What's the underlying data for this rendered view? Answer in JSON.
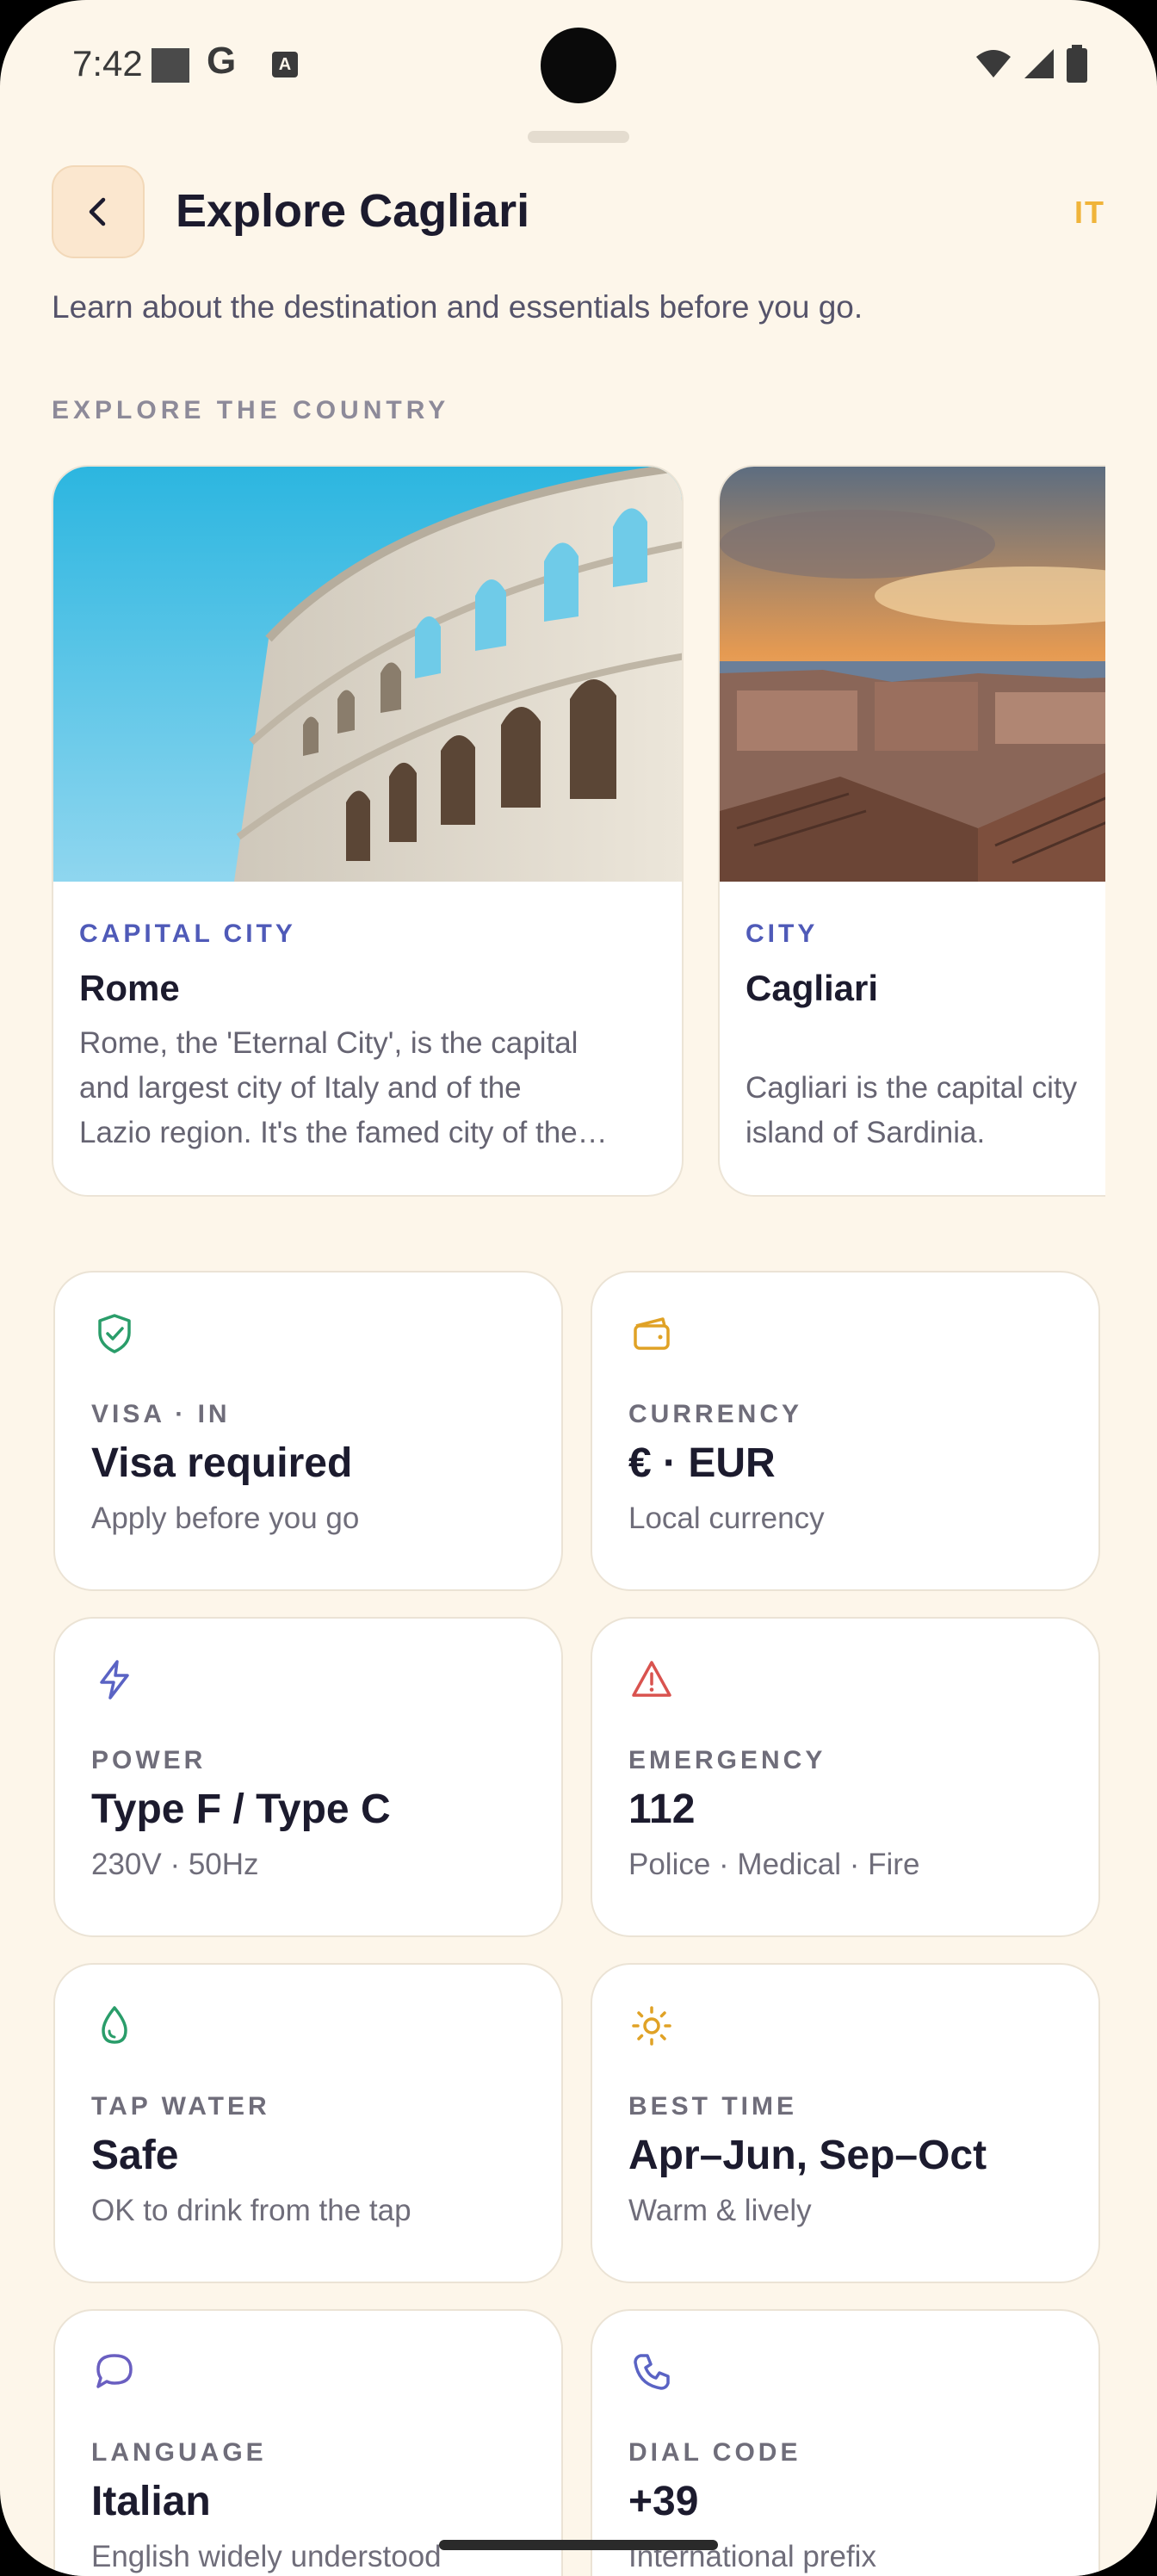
{
  "status_bar": {
    "time": "7:42",
    "g_glyph": "G",
    "a_glyph": "A",
    "icons": [
      "wifi-icon",
      "signal-icon",
      "battery-icon"
    ]
  },
  "header": {
    "title": "Explore Cagliari",
    "lang_code": "IT",
    "back_icon": "chevron-left-icon"
  },
  "subtitle": "Learn about the destination and essentials before you go.",
  "section_label": "EXPLORE THE COUNTRY",
  "places": [
    {
      "kind": "CAPITAL CITY",
      "name": "Rome",
      "desc_lines": [
        "Rome, the 'Eternal City', is the capital",
        "and largest city of Italy and of the",
        "Lazio region. It's the famed city of the…"
      ]
    },
    {
      "kind": "CITY",
      "name": "Cagliari",
      "desc_lines": [
        "Cagliari is the capital city",
        "island of Sardinia."
      ]
    }
  ],
  "info": {
    "visa": {
      "label": "VISA · IN",
      "value": "Visa required",
      "note": "Apply before you go",
      "icon": "shield-check-icon",
      "color": "#2a9d6a"
    },
    "currency": {
      "label": "CURRENCY",
      "value": "€ · EUR",
      "note": "Local currency",
      "icon": "wallet-icon",
      "color": "#e0a226"
    },
    "power": {
      "label": "POWER",
      "value": "Type F / Type C",
      "note": "230V · 50Hz",
      "icon": "lightning-icon",
      "color": "#5a63c4"
    },
    "emergency": {
      "label": "EMERGENCY",
      "value": "112",
      "note": "Police · Medical · Fire",
      "icon": "warning-icon",
      "color": "#d9534f"
    },
    "water": {
      "label": "TAP WATER",
      "value": "Safe",
      "note": "OK to drink from the tap",
      "icon": "droplet-icon",
      "color": "#2a9d6a"
    },
    "best_time": {
      "label": "BEST TIME",
      "value": "Apr–Jun, Sep–Oct",
      "note": "Warm & lively",
      "icon": "sun-icon",
      "color": "#e0a226"
    },
    "language": {
      "label": "LANGUAGE",
      "value": "Italian",
      "note": "English widely understood",
      "icon": "chat-bubble-icon",
      "color": "#6a5fc1"
    },
    "dial_code": {
      "label": "DIAL CODE",
      "value": "+39",
      "note": "International prefix",
      "icon": "phone-icon",
      "color": "#5a63c4"
    }
  }
}
